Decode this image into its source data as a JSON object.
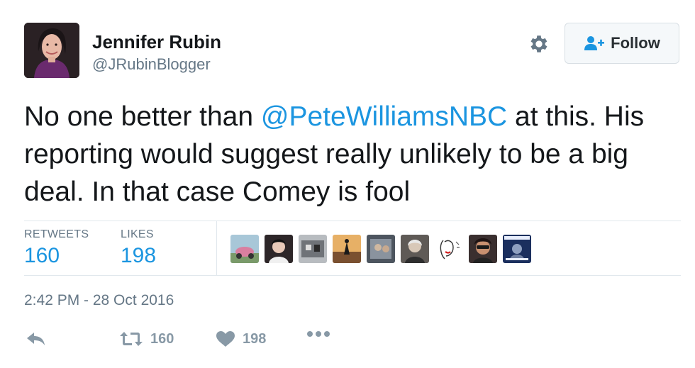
{
  "author": {
    "name": "Jennifer Rubin",
    "handle": "@JRubinBlogger",
    "avatar_icon": "profile-photo"
  },
  "header": {
    "settings_icon": "gear-icon",
    "follow_label": "Follow",
    "follow_icon": "add-user-icon"
  },
  "tweet": {
    "text_before": "No one better than ",
    "mention": "@PeteWilliamsNBC",
    "text_after": " at this. His reporting would suggest really unlikely to be a big deal. In that case Comey is fool"
  },
  "stats": {
    "retweets_label": "RETWEETS",
    "retweets_value": "160",
    "likes_label": "LIKES",
    "likes_value": "198"
  },
  "likers": [
    {
      "name": "liker-avatar-1",
      "color": "#c9788f"
    },
    {
      "name": "liker-avatar-2",
      "color": "#3a3236"
    },
    {
      "name": "liker-avatar-3",
      "color": "#8a8f95"
    },
    {
      "name": "liker-avatar-4",
      "color": "#b07a3c"
    },
    {
      "name": "liker-avatar-5",
      "color": "#5c6470"
    },
    {
      "name": "liker-avatar-6",
      "color": "#6f6a66"
    },
    {
      "name": "liker-avatar-7",
      "color": "#ffffff"
    },
    {
      "name": "liker-avatar-8",
      "color": "#3b3030"
    },
    {
      "name": "liker-avatar-9",
      "color": "#1f3f7a"
    }
  ],
  "timestamp": "2:42 PM - 28 Oct 2016",
  "actions": {
    "reply_icon": "reply-icon",
    "retweet_icon": "retweet-icon",
    "retweet_count": "160",
    "like_icon": "heart-icon",
    "like_count": "198",
    "more_icon": "more-icon"
  },
  "colors": {
    "link": "#1b95e0",
    "muted": "#657786",
    "action_gray": "#8899a6",
    "text": "#14171a",
    "border": "#e1e8ed"
  }
}
